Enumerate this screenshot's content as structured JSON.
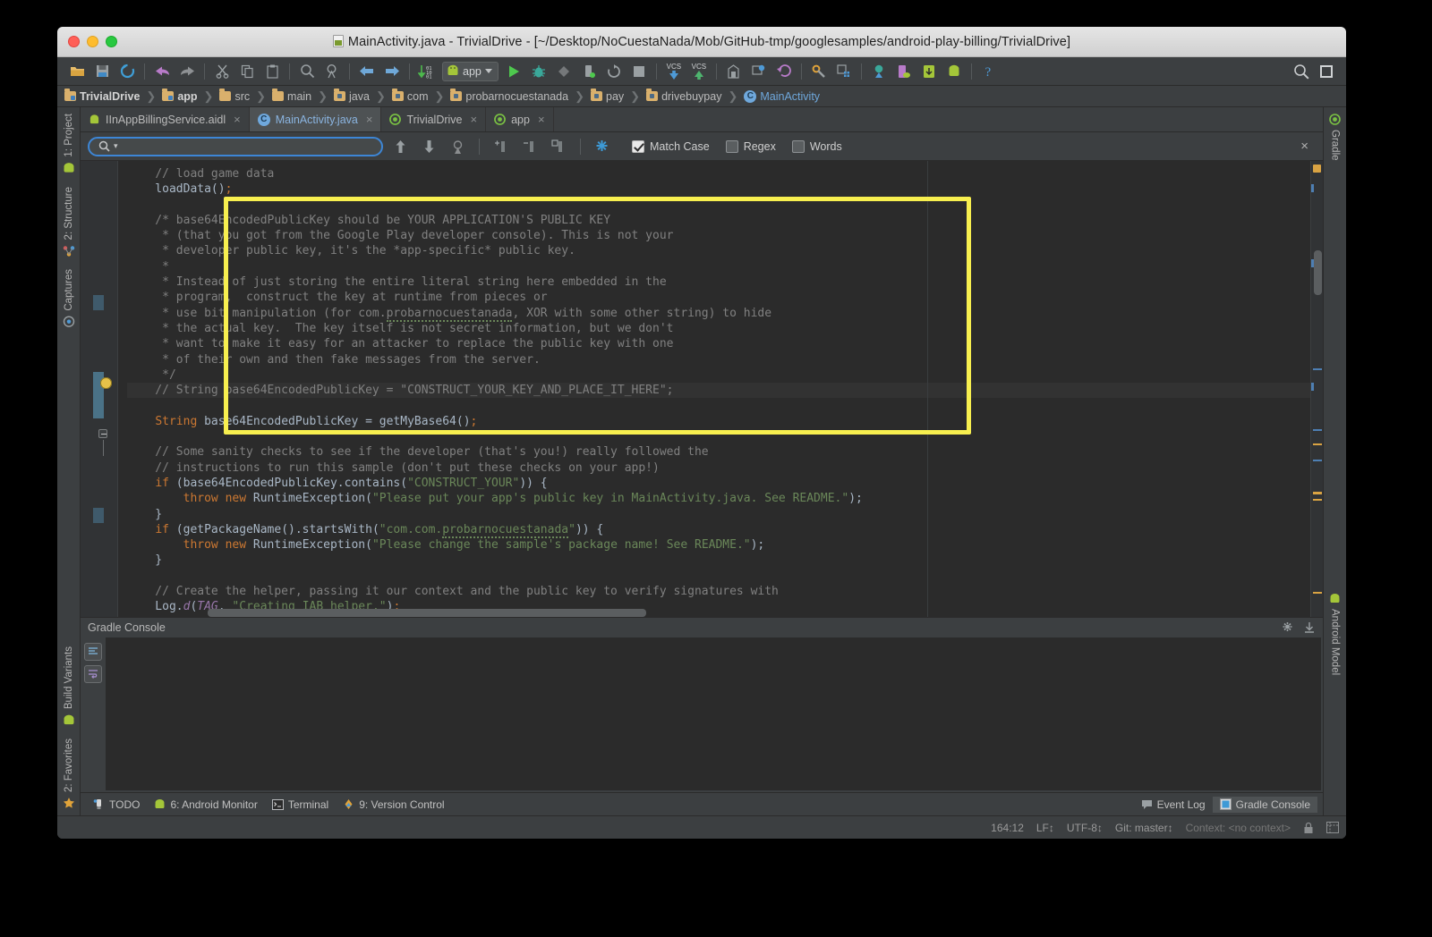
{
  "window": {
    "title": "MainActivity.java - TrivialDrive - [~/Desktop/NoCuestaNada/Mob/GitHub-tmp/googlesamples/android-play-billing/TrivialDrive]"
  },
  "toolbar": {
    "run_config_label": "app",
    "vcs_update_label": "VCS",
    "vcs_commit_label": "VCS",
    "icons": [
      "open-folder-icon",
      "save-all-icon",
      "sync-icon",
      "undo-icon",
      "redo-icon",
      "cut-icon",
      "copy-icon",
      "paste-icon",
      "find-icon",
      "find-usages-icon",
      "back-icon",
      "forward-icon",
      "compile-icon",
      "run-icon",
      "debug-icon",
      "coverage-icon",
      "attach-debugger-icon",
      "rerun-icon",
      "stop-icon",
      "vcs-update-icon",
      "vcs-commit-icon",
      "avd-manager-icon",
      "sdk-manager-icon",
      "revert-icon",
      "project-structure-icon",
      "gradle-sync-icon",
      "monitor-icon",
      "device-file-icon",
      "sdk-download-icon",
      "android-icon",
      "help-icon",
      "search-everywhere-icon",
      "layout-inspector-icon"
    ]
  },
  "breadcrumbs": [
    {
      "label": "TrivialDrive",
      "icon": "module-folder-icon"
    },
    {
      "label": "app",
      "icon": "module-folder-icon"
    },
    {
      "label": "src",
      "icon": "folder-icon"
    },
    {
      "label": "main",
      "icon": "folder-icon"
    },
    {
      "label": "java",
      "icon": "source-folder-icon"
    },
    {
      "label": "com",
      "icon": "package-icon"
    },
    {
      "label": "probarnocuestanada",
      "icon": "package-icon"
    },
    {
      "label": "pay",
      "icon": "package-icon"
    },
    {
      "label": "drivebuypay",
      "icon": "package-icon"
    },
    {
      "label": "MainActivity",
      "icon": "java-class-icon"
    }
  ],
  "tabs": [
    {
      "label": "IInAppBillingService.aidl",
      "icon": "android-icon",
      "active": false,
      "close": "×"
    },
    {
      "label": "MainActivity.java",
      "icon": "java-class-icon",
      "active": true,
      "close": "×"
    },
    {
      "label": "TrivialDrive",
      "icon": "gradle-icon",
      "active": false,
      "close": "×"
    },
    {
      "label": "app",
      "icon": "gradle-icon",
      "active": false,
      "close": "×"
    }
  ],
  "find": {
    "placeholder": "",
    "value": "",
    "search_icon": "search-icon",
    "buttons": [
      "find-prev-icon",
      "find-next-icon",
      "select-all-occurrences-icon",
      "add-line-icon",
      "remove-line-icon",
      "toggle-lines-icon",
      "filter-settings-icon"
    ],
    "options": [
      {
        "label": "Match Case",
        "checked": true,
        "underline": "C"
      },
      {
        "label": "Regex",
        "checked": false,
        "underline": "g"
      },
      {
        "label": "Words",
        "checked": false,
        "underline": "r"
      }
    ],
    "close_label": "×"
  },
  "left_rail": [
    {
      "label": "1: Project",
      "icon": "project-icon"
    },
    {
      "label": "2: Structure",
      "icon": "structure-icon"
    },
    {
      "label": "Captures",
      "icon": "captures-icon"
    },
    {
      "label": "Build Variants",
      "icon": "build-variants-icon"
    },
    {
      "label": "2: Favorites",
      "icon": "favorites-icon"
    }
  ],
  "right_rail": [
    {
      "label": "Gradle",
      "icon": "gradle-icon"
    },
    {
      "label": "Android Model",
      "icon": "android-icon"
    }
  ],
  "editor": {
    "lines": [
      {
        "segments": [
          {
            "t": "    ",
            "c": "pn"
          },
          {
            "t": "// load game data",
            "c": "cm"
          }
        ]
      },
      {
        "segments": [
          {
            "t": "    loadData()",
            "c": "pn"
          },
          {
            "t": ";",
            "c": "semi"
          }
        ]
      },
      {
        "segments": []
      },
      {
        "segments": [
          {
            "t": "    /* base64EncodedPublicKey should be YOUR APPLICATION'S PUBLIC KEY",
            "c": "cm"
          }
        ]
      },
      {
        "segments": [
          {
            "t": "     * (that you got from the Google Play developer console). This is not your",
            "c": "cm"
          }
        ]
      },
      {
        "segments": [
          {
            "t": "     * developer public key, it's the *app-specific* public key.",
            "c": "cm"
          }
        ]
      },
      {
        "segments": [
          {
            "t": "     *",
            "c": "cm"
          }
        ]
      },
      {
        "segments": [
          {
            "t": "     * Instead of just storing the entire literal string here embedded in the",
            "c": "cm"
          }
        ]
      },
      {
        "segments": [
          {
            "t": "     * program,  construct the key at runtime from pieces or",
            "c": "cm"
          }
        ]
      },
      {
        "segments": [
          {
            "t": "     * use bit manipulation (for com.",
            "c": "cm"
          },
          {
            "t": "probarnocuestanada",
            "c": "cm typo"
          },
          {
            "t": ", XOR with some other string) to hide",
            "c": "cm"
          }
        ]
      },
      {
        "segments": [
          {
            "t": "     * the actual key.  The key itself is not secret information, but we don't",
            "c": "cm"
          }
        ]
      },
      {
        "segments": [
          {
            "t": "     * want to make it easy for an attacker to replace the public key with one",
            "c": "cm"
          }
        ]
      },
      {
        "segments": [
          {
            "t": "     * of their own and then fake messages from the server.",
            "c": "cm"
          }
        ]
      },
      {
        "segments": [
          {
            "t": "     */",
            "c": "cm"
          }
        ]
      },
      {
        "highlight": true,
        "segments": [
          {
            "t": "    // String base64EncodedPublicKey = \"CONSTRUCT_YOUR_KEY_AND_PLACE_IT_HERE\";",
            "c": "cm"
          }
        ]
      },
      {
        "segments": []
      },
      {
        "segments": [
          {
            "t": "    ",
            "c": "pn"
          },
          {
            "t": "String",
            "c": "kw"
          },
          {
            "t": " base64EncodedPublicKey = getMyBase64()",
            "c": "pn"
          },
          {
            "t": ";",
            "c": "semi"
          }
        ]
      },
      {
        "segments": []
      },
      {
        "segments": [
          {
            "t": "    // Some sanity checks to see if the developer (that's you!) really followed the",
            "c": "cm"
          }
        ]
      },
      {
        "segments": [
          {
            "t": "    // instructions to run this sample (don't put these checks on your app!)",
            "c": "cm"
          }
        ]
      },
      {
        "segments": [
          {
            "t": "    ",
            "c": "pn"
          },
          {
            "t": "if",
            "c": "kw"
          },
          {
            "t": " (base64EncodedPublicKey.contains(",
            "c": "pn"
          },
          {
            "t": "\"CONSTRUCT_YOUR\"",
            "c": "str"
          },
          {
            "t": ")) {",
            "c": "pn"
          }
        ]
      },
      {
        "segments": [
          {
            "t": "        ",
            "c": "pn"
          },
          {
            "t": "throw new",
            "c": "kw"
          },
          {
            "t": " RuntimeException(",
            "c": "pn"
          },
          {
            "t": "\"Please put your app's public key in MainActivity.java. See README.\"",
            "c": "str"
          },
          {
            "t": ");",
            "c": "pn"
          }
        ]
      },
      {
        "segments": [
          {
            "t": "    }",
            "c": "pn"
          }
        ]
      },
      {
        "segments": [
          {
            "t": "    ",
            "c": "pn"
          },
          {
            "t": "if",
            "c": "kw"
          },
          {
            "t": " (getPackageName().startsWith(",
            "c": "pn"
          },
          {
            "t": "\"com.com.",
            "c": "str"
          },
          {
            "t": "probarnocuestanada",
            "c": "str typo"
          },
          {
            "t": "\"",
            "c": "str"
          },
          {
            "t": ")) {",
            "c": "pn"
          }
        ]
      },
      {
        "segments": [
          {
            "t": "        ",
            "c": "pn"
          },
          {
            "t": "throw new",
            "c": "kw"
          },
          {
            "t": " RuntimeException(",
            "c": "pn"
          },
          {
            "t": "\"Please change the sample's package name! See README.\"",
            "c": "str"
          },
          {
            "t": ");",
            "c": "pn"
          }
        ]
      },
      {
        "segments": [
          {
            "t": "    }",
            "c": "pn"
          }
        ]
      },
      {
        "segments": []
      },
      {
        "segments": [
          {
            "t": "    // Create the helper, passing it our context and the public key to verify signatures with",
            "c": "cm"
          }
        ]
      },
      {
        "segments": [
          {
            "t": "    Log.",
            "c": "pn"
          },
          {
            "t": "d",
            "c": "fld-col"
          },
          {
            "t": "(",
            "c": "pn"
          },
          {
            "t": "TAG",
            "c": "fld-col"
          },
          {
            "t": ", ",
            "c": "pn"
          },
          {
            "t": "\"Creating IAB helper.\"",
            "c": "str"
          },
          {
            "t": ")",
            "c": "pn"
          },
          {
            "t": ";",
            "c": "semi"
          }
        ]
      }
    ],
    "highlight_box": {
      "color": "#f7ef4f"
    }
  },
  "tool_window": {
    "title": "Gradle Console",
    "content": "",
    "header_icons": [
      "settings-icon",
      "hide-icon"
    ],
    "side_buttons": [
      "scroll-to-end-icon",
      "soft-wrap-icon"
    ]
  },
  "bottom_bar": {
    "left": [
      {
        "label": "TODO",
        "icon": "todo-icon",
        "selected": false
      },
      {
        "label": "6: Android Monitor",
        "icon": "android-monitor-icon",
        "selected": false,
        "underline": "6"
      },
      {
        "label": "Terminal",
        "icon": "terminal-icon",
        "selected": false
      },
      {
        "label": "9: Version Control",
        "icon": "version-control-icon",
        "selected": false,
        "underline": "9"
      }
    ],
    "right": [
      {
        "label": "Event Log",
        "icon": "event-log-icon",
        "selected": false
      },
      {
        "label": "Gradle Console",
        "icon": "gradle-console-icon",
        "selected": true
      }
    ]
  },
  "status_bar": {
    "caret_position": "164:12",
    "line_separator": "LF↕",
    "encoding": "UTF-8↕",
    "branch": "Git: master↕",
    "context": "Context: <no context>",
    "lock_icon": "lock-icon",
    "inspector_icon": "layout-inspector-icon"
  }
}
